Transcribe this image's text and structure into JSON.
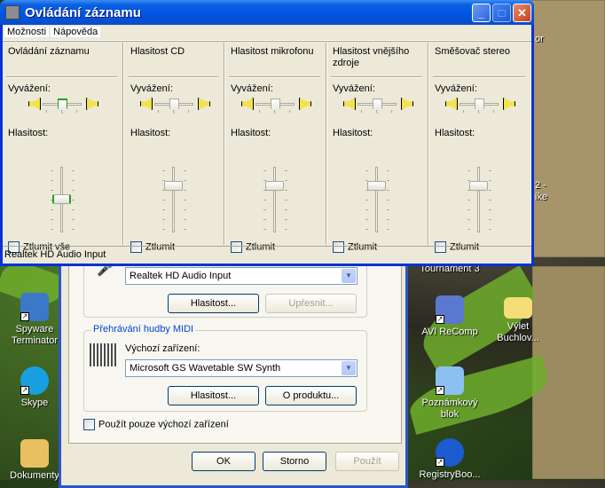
{
  "window": {
    "title": "Ovládání záznamu",
    "menu": [
      "Možnosti",
      "Nápověda"
    ],
    "status": "Realtek HD Audio Input",
    "balance_label": "Vyvážení:",
    "volume_label": "Hlasitost:",
    "columns": [
      {
        "name": "Ovládání záznamu",
        "mute_label": "Ztlumit vše",
        "muted": false,
        "balance": 0,
        "volume": 0.5,
        "active": true
      },
      {
        "name": "Hlasitost CD",
        "mute_label": "Ztlumit",
        "muted": false,
        "balance": 0,
        "volume": 0.75,
        "active": false
      },
      {
        "name": "Hlasitost mikrofonu",
        "mute_label": "Ztlumit",
        "muted": false,
        "balance": 0,
        "volume": 0.75,
        "active": false
      },
      {
        "name": "Hlasitost vnějšího zdroje",
        "mute_label": "Ztlumit",
        "muted": false,
        "balance": 0,
        "volume": 0.75,
        "active": false
      },
      {
        "name": "Směšovač stereo",
        "mute_label": "Ztlumit",
        "muted": false,
        "balance": 0,
        "volume": 0.75,
        "active": false
      }
    ]
  },
  "dialog": {
    "recording_device": "Realtek HD Audio Input",
    "rec_volume": "Hlasitost...",
    "rec_advanced": "Upřesnit...",
    "midi_group": "Přehrávání hudby MIDI",
    "midi_default_label": "Výchozí zařízení:",
    "midi_device": "Microsoft GS Wavetable SW Synth",
    "midi_volume": "Hlasitost...",
    "midi_about": "O produktu...",
    "use_default_only": "Použít pouze výchozí zařízení",
    "ok": "OK",
    "cancel": "Storno",
    "apply": "Použít"
  },
  "desktop": {
    "icons": [
      "Spyware Terminator",
      "Skype",
      "Dokumenty",
      "Tournament 3",
      "AVI ReComp",
      "Výlet Buchlov...",
      "Poznámkový blok",
      "RegistryBoo..."
    ],
    "partial_labels": [
      "or",
      "2 -",
      "ike"
    ]
  }
}
